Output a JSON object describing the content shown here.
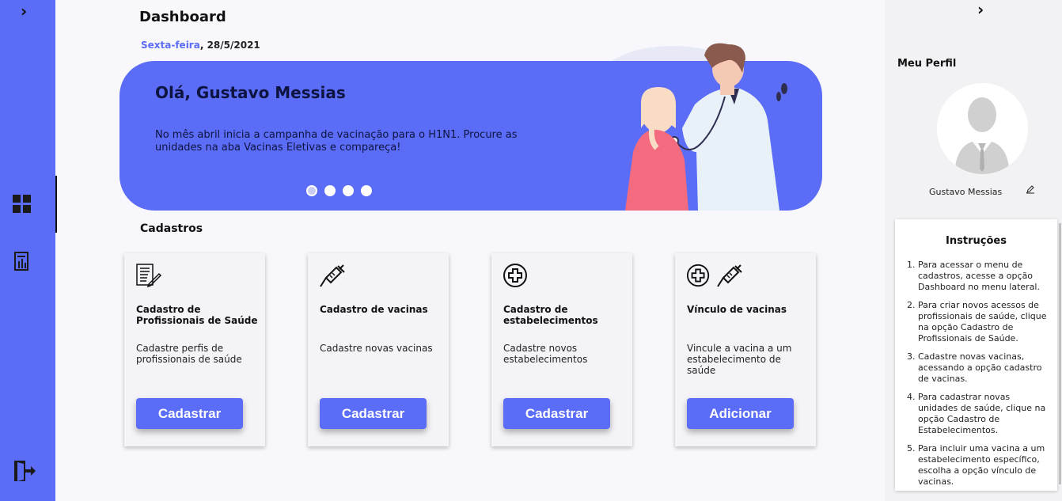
{
  "sidebar": {
    "expand_icon": "chevron-right-icon",
    "items": [
      {
        "icon": "dashboard-icon",
        "active": true
      },
      {
        "icon": "report-icon",
        "active": false
      },
      {
        "icon": "logout-icon",
        "active": false
      }
    ]
  },
  "header": {
    "title": "Dashboard",
    "date_day": "Sexta-feira",
    "date_rest": ", 28/5/2021"
  },
  "banner": {
    "greeting": "Olá, Gustavo Messias",
    "message": "No mês abril inicia a campanha de vacinação para o H1N1. Procure as unidades na aba Vacinas Eletivas e compareça!",
    "slides": 4,
    "active_slide": 1
  },
  "cadastros": {
    "title": "Cadastros",
    "cards": [
      {
        "title": "Cadastro de Profissionais de Saúde",
        "description": "Cadastre perfis de profissionais de saúde",
        "button": "Cadastrar",
        "icons": [
          "document-form-icon"
        ]
      },
      {
        "title": "Cadastro de vacinas",
        "description": "Cadastre novas vacinas",
        "button": "Cadastrar",
        "icons": [
          "syringe-icon"
        ]
      },
      {
        "title": "Cadastro de estabelecimentos",
        "description": "Cadastre novos estabelecimentos",
        "button": "Cadastrar",
        "icons": [
          "medical-cross-icon"
        ]
      },
      {
        "title": "Vínculo de vacinas",
        "description": "Vincule a vacina a um estabelecimento de saúde",
        "button": "Adicionar",
        "icons": [
          "medical-cross-icon",
          "syringe-icon"
        ]
      }
    ]
  },
  "profile": {
    "title": "Meu Perfil",
    "name": "Gustavo Messias"
  },
  "instructions": {
    "title": "Instruções",
    "items": [
      "Para acessar o menu de cadastros, acesse a opção Dashboard no menu lateral.",
      "Para criar novos acessos de profissionais de saúde, clique na opção Cadastro de Profissionais de Saúde.",
      "Cadastre novas vacinas, acessando a opção cadastro de vacinas.",
      "Para cadastrar novas unidades de saúde, clique na opção Cadastro de Estabelecimentos.",
      "Para incluir uma vacina a um estabelecimento específico, escolha a opção vínculo de vacinas."
    ]
  },
  "colors": {
    "accent": "#5b6cf6",
    "banner_text": "#0e1440",
    "card_bg": "#f4f4f8"
  }
}
